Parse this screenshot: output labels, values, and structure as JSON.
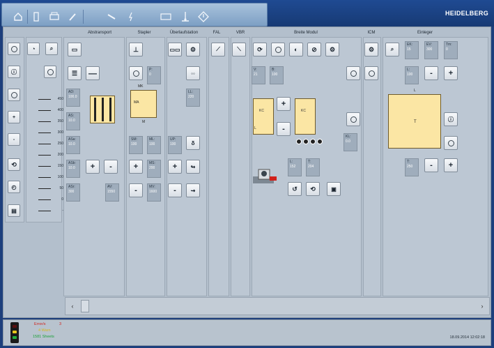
{
  "brand": "HEIDELBERG",
  "toolbar": {
    "icons": [
      "home-icon",
      "door-icon",
      "printer-icon",
      "brush-icon",
      "wrench-icon",
      "flash-icon",
      "card-icon",
      "stand-icon",
      "diamond-icon"
    ]
  },
  "columns": {
    "abstransport": "Abstransport",
    "stapler": "Stapler",
    "ueberstation": "Überlaufstation",
    "fal": "FAL",
    "vbr": "VBR",
    "breite": "Breite Modul",
    "icm": "ICM",
    "einleger": "Einleger"
  },
  "scale": {
    "values": [
      "450",
      "400",
      "350",
      "300",
      "250",
      "200",
      "150",
      "100",
      "50",
      "0",
      "-"
    ]
  },
  "abs": {
    "ad_label": "AD:",
    "ad_value": "100.0",
    "as_label": "AS:",
    "as_value": "10.0",
    "asa_label": "ASa:",
    "asa_value": "10.0",
    "asb_label": "ASb:",
    "asb_value": "10.0",
    "asr_label": "ASr:",
    "asr_value": "300",
    "av_label": "AV:",
    "av_value": "1550"
  },
  "sta": {
    "p_label": "P:",
    "p_value": "0",
    "sm_label": "SM:",
    "sm_value": "100",
    "ml_label": "ML:",
    "ml_value": "100",
    "ms_label": "MS:",
    "ms_value": "200",
    "mv_label": "MV:",
    "mv_value": "1600",
    "mk_label": "MK",
    "ma_label": "MA",
    "m_label": "M"
  },
  "ueb": {
    "ll_label": "LL:",
    "ll_value": "220",
    "up_label": "UP:",
    "up_value": "100"
  },
  "bm": {
    "v_label": "V:",
    "v_value": "21",
    "b_label": "B:",
    "b_value": "100",
    "l_label": "L:",
    "l_value": "152",
    "t_label": "T:",
    "t_value": "204",
    "kl_label": "KL:",
    "kl_value": "0.0",
    "kc_label": "KC",
    "kl_head": "L"
  },
  "ein": {
    "ek_label": "EK:",
    "ek_value": "15",
    "ev_label": "EV:",
    "ev_value": "300",
    "tm_label": "Tm:",
    "tm_value": "0",
    "l_label": "L:",
    "l_value": "100",
    "t_label": "T:",
    "t_value": "250",
    "t_head": "T",
    "l_head": "L"
  },
  "status": {
    "error_label": "Error/s",
    "error_count": "3",
    "warn_label": "4 Warn",
    "sheets_label": "1581 Sheets",
    "datetime": "18.09.2014 12:02:18"
  },
  "colors": {
    "accent_blue": "#1d3f7c",
    "module_yellow": "#fbe6a4",
    "error_red": "#d0211a",
    "warn_yellow": "#e6c51c",
    "ok_green": "#23b03c"
  }
}
